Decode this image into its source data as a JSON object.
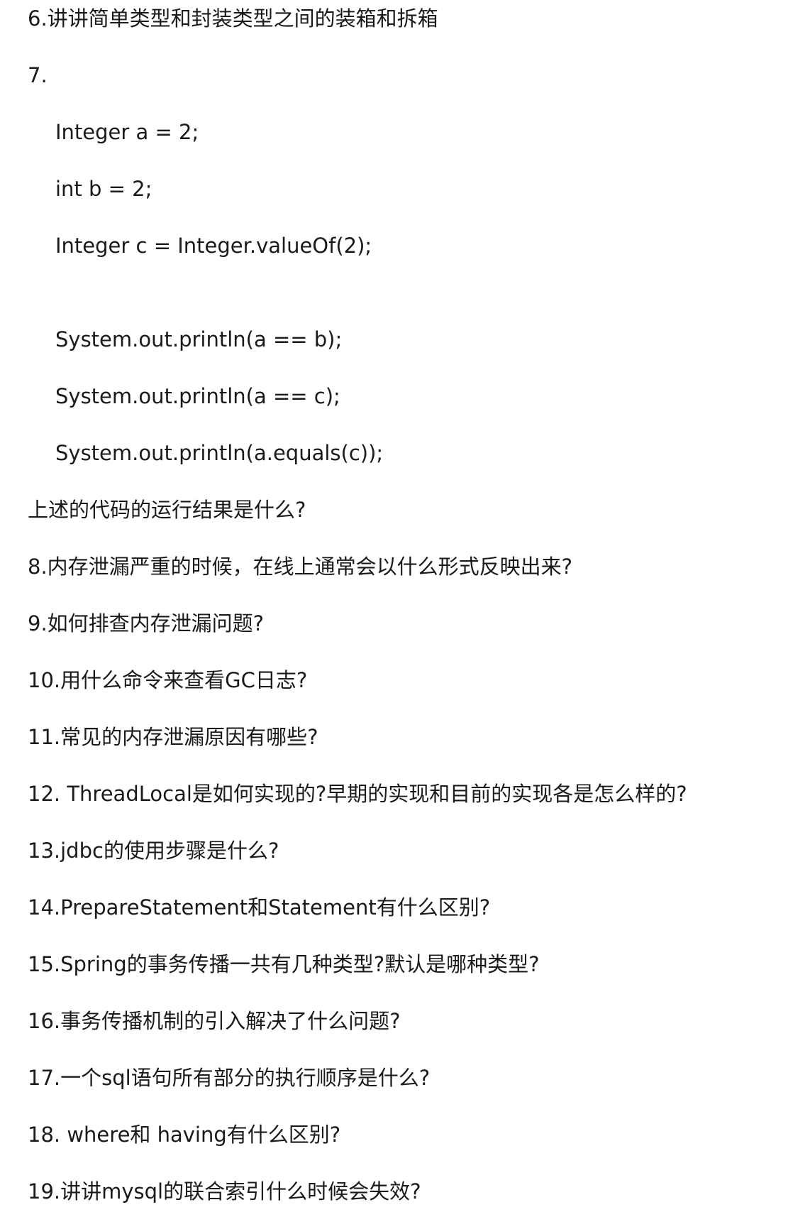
{
  "lines": [
    {
      "text": "6.讲讲简单类型和封装类型之间的装箱和拆箱",
      "indent": false
    },
    {
      "text": "7.",
      "indent": false
    },
    {
      "text": "Integer a = 2;",
      "indent": true
    },
    {
      "text": "int b = 2;",
      "indent": true
    },
    {
      "text": "Integer c = Integer.valueOf(2);",
      "indent": true
    },
    {
      "text": "System.out.println(a == b);",
      "indent": true
    },
    {
      "text": "System.out.println(a == c);",
      "indent": true
    },
    {
      "text": "System.out.println(a.equals(c));",
      "indent": true
    },
    {
      "text": "上述的代码的运行结果是什么?",
      "indent": false
    },
    {
      "text": "8.内存泄漏严重的时候，在线上通常会以什么形式反映出来?",
      "indent": false
    },
    {
      "text": "9.如何排查内存泄漏问题?",
      "indent": false
    },
    {
      "text": "10.用什么命令来查看GC日志?",
      "indent": false
    },
    {
      "text": "11.常见的内存泄漏原因有哪些?",
      "indent": false
    },
    {
      "text": "12. ThreadLocal是如何实现的?早期的实现和目前的实现各是怎么样的?",
      "indent": false
    },
    {
      "text": "13.jdbc的使用步骤是什么?",
      "indent": false
    },
    {
      "text": "14.PrepareStatement和Statement有什么区别?",
      "indent": false
    },
    {
      "text": "15.Spring的事务传播一共有几种类型?默认是哪种类型?",
      "indent": false
    },
    {
      "text": "16.事务传播机制的引入解决了什么问题?",
      "indent": false
    },
    {
      "text": "17.一个sql语句所有部分的执行顺序是什么?",
      "indent": false
    },
    {
      "text": "18. where和 having有什么区别?",
      "indent": false
    },
    {
      "text": "19.讲讲mysql的联合索引什么时候会失效?",
      "indent": false
    }
  ]
}
